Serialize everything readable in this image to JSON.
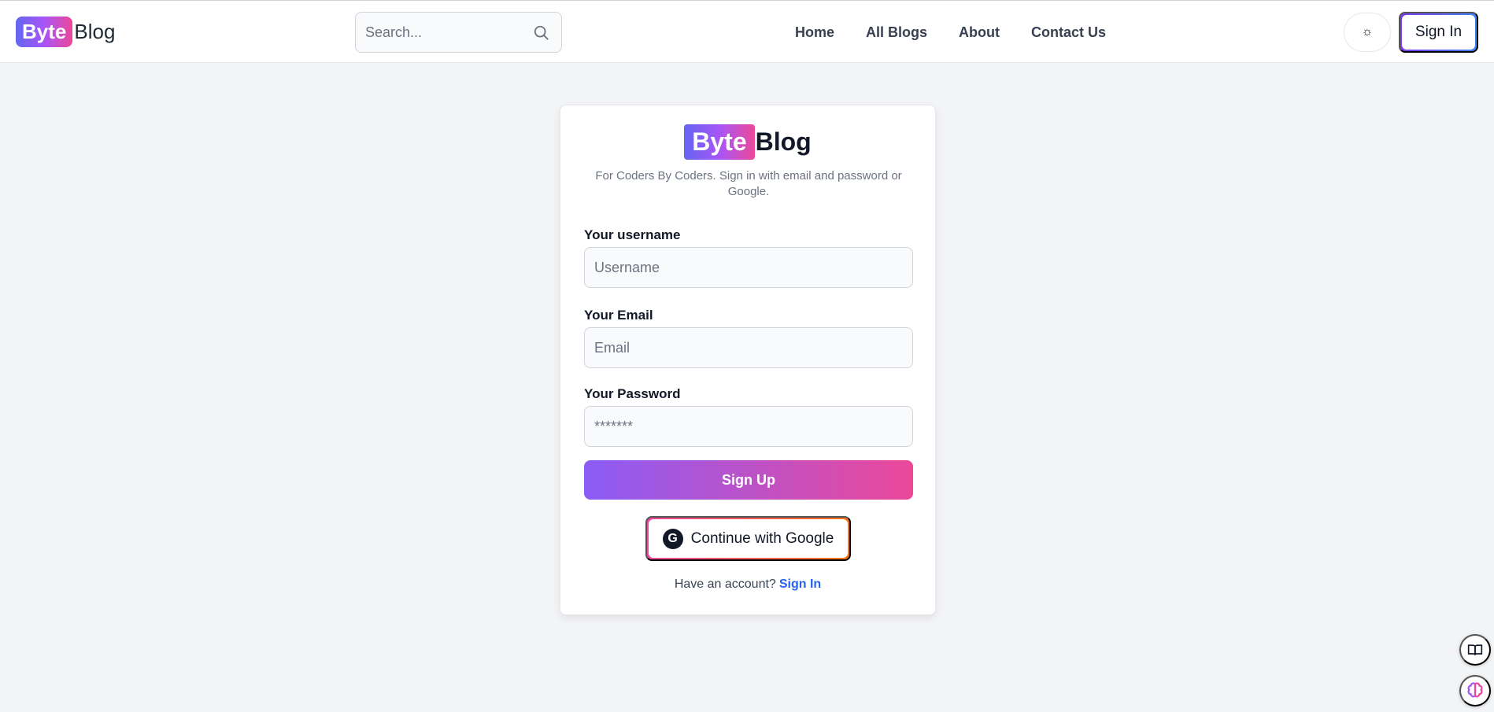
{
  "navbar": {
    "logo": {
      "highlight": "Byte",
      "rest": "Blog"
    },
    "search": {
      "placeholder": "Search...",
      "icon": "search-icon"
    },
    "links": [
      "Home",
      "All Blogs",
      "About",
      "Contact Us"
    ],
    "theme_toggle_icon": "☼",
    "sign_in_label": "Sign In"
  },
  "card": {
    "logo": {
      "highlight": "Byte",
      "rest": "Blog"
    },
    "tagline": "For Coders By Coders. Sign in with email and password or Google.",
    "username": {
      "label": "Your username",
      "placeholder": "Username"
    },
    "email": {
      "label": "Your Email",
      "placeholder": "Email"
    },
    "password": {
      "label": "Your Password",
      "placeholder": "*******"
    },
    "sign_up_label": "Sign Up",
    "google": {
      "icon_letter": "G",
      "label": "Continue with Google"
    },
    "account_prompt": "Have an account?",
    "sign_in_link": "Sign In"
  },
  "floating": [
    "book-icon",
    "brain-icon"
  ],
  "colors": {
    "gradient_start": "#8b5cf6",
    "gradient_end": "#ec4899",
    "link": "#2563eb",
    "page_bg": "#f3f4f6"
  }
}
